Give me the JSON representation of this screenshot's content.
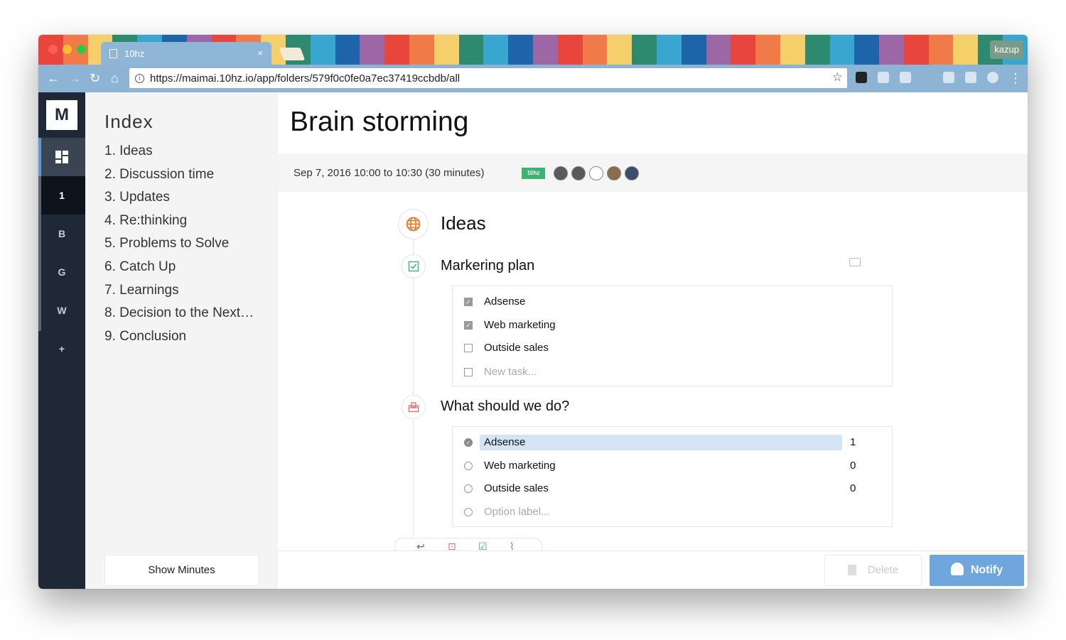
{
  "browser": {
    "tab_title": "10hz",
    "tab_close": "×",
    "profile": "kazup",
    "url": "https://maimai.10hz.io/app/folders/579f0c0fe0a7ec37419ccbdb/all",
    "nav": {
      "back": "←",
      "forward": "→",
      "reload": "↻",
      "home": "⌂",
      "star": "☆",
      "menu": "⋮"
    },
    "info_icon": "i",
    "stripe_colors": [
      "#e8453c",
      "#f07a48",
      "#f5d06a",
      "#2d8a6e",
      "#39a6d0",
      "#1e64a8",
      "#9d66a4",
      "#e8453c",
      "#f07a48",
      "#f5d06a",
      "#2d8a6e",
      "#39a6d0",
      "#1e64a8",
      "#9d66a4",
      "#e8453c",
      "#f07a48",
      "#f5d06a",
      "#2d8a6e",
      "#39a6d0",
      "#1e64a8",
      "#9d66a4",
      "#e8453c",
      "#f07a48",
      "#f5d06a",
      "#2d8a6e",
      "#39a6d0",
      "#1e64a8",
      "#9d66a4",
      "#e8453c",
      "#f07a48",
      "#f5d06a",
      "#2d8a6e",
      "#39a6d0",
      "#1e64a8",
      "#9d66a4",
      "#e8453c",
      "#f07a48",
      "#f5d06a",
      "#2d8a6e",
      "#39a6d0"
    ]
  },
  "rail": {
    "logo": "M",
    "items": [
      "1",
      "B",
      "G",
      "W",
      "+"
    ]
  },
  "index": {
    "title": "Index",
    "items": [
      "1. Ideas",
      "2. Discussion time",
      "3. Updates",
      "4. Re:thinking",
      "5. Problems to Solve",
      "6. Catch Up",
      "7. Learnings",
      "8. Decision to the Next…",
      "9. Conclusion"
    ],
    "show_minutes": "Show Minutes"
  },
  "meeting": {
    "title": "Brain storming",
    "when": "Sep 7, 2016 10:00 to 10:30 (30 minutes)",
    "badge": "10hz",
    "section_title": "Ideas",
    "tasks": {
      "heading": "Markering plan",
      "items": [
        {
          "label": "Adsense",
          "checked": true
        },
        {
          "label": "Web marketing",
          "checked": true
        },
        {
          "label": "Outside sales",
          "checked": false
        }
      ],
      "placeholder": "New task..."
    },
    "vote": {
      "heading": "What should we do?",
      "options": [
        {
          "label": "Adsense",
          "count": "1",
          "selected": true
        },
        {
          "label": "Web marketing",
          "count": "0",
          "selected": false
        },
        {
          "label": "Outside sales",
          "count": "0",
          "selected": false
        }
      ],
      "placeholder": "Option label..."
    }
  },
  "actions": {
    "delete": "Delete",
    "notify": "Notify"
  },
  "colors": {
    "accent": "#6fa6dd",
    "rail": "#1f2836",
    "badge": "#3cb371"
  }
}
